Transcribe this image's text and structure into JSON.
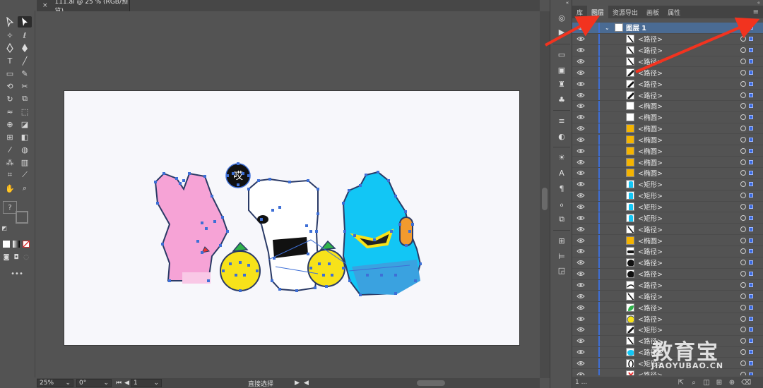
{
  "document": {
    "tab_title": "111.ai @ 25 % (RGB/预览)",
    "close_glyph": "×"
  },
  "status_bar": {
    "zoom": "25%",
    "rotation": "0°",
    "artboard_number": "1",
    "current_tool": "直接选择"
  },
  "panel": {
    "tabs": [
      "库",
      "图层",
      "资源导出",
      "画板",
      "属性"
    ],
    "active_tab": "图层",
    "layer_name": "图层 1",
    "footer_text": "1 ...",
    "items": [
      {
        "label": "<路径>",
        "thumb": "stroke-diag"
      },
      {
        "label": "<路径>",
        "thumb": "stroke-diag"
      },
      {
        "label": "<路径>",
        "thumb": "stroke-diag"
      },
      {
        "label": "<路径>",
        "thumb": "stroke-diag-bold"
      },
      {
        "label": "<路径>",
        "thumb": "stroke-diag-bold"
      },
      {
        "label": "<路径>",
        "thumb": "stroke-diag-bold"
      },
      {
        "label": "<椭圆>",
        "thumb": "white"
      },
      {
        "label": "<椭圆>",
        "thumb": "white"
      },
      {
        "label": "<椭圆>",
        "thumb": "orange"
      },
      {
        "label": "<椭圆>",
        "thumb": "orange"
      },
      {
        "label": "<椭圆>",
        "thumb": "orange"
      },
      {
        "label": "<椭圆>",
        "thumb": "orange"
      },
      {
        "label": "<椭圆>",
        "thumb": "orange"
      },
      {
        "label": "<矩形>",
        "thumb": "cyan-rect"
      },
      {
        "label": "<矩形>",
        "thumb": "cyan-rect"
      },
      {
        "label": "<矩形>",
        "thumb": "cyan-rect"
      },
      {
        "label": "<矩形>",
        "thumb": "cyan-rect"
      },
      {
        "label": "<路径>",
        "thumb": "stroke-diag"
      },
      {
        "label": "<椭圆>",
        "thumb": "orange"
      },
      {
        "label": "<路径>",
        "thumb": "black-bar"
      },
      {
        "label": "<路径>",
        "thumb": "black-blob"
      },
      {
        "label": "<路径>",
        "thumb": "black-blob"
      },
      {
        "label": "<路径>",
        "thumb": "stroke-arc"
      },
      {
        "label": "<路径>",
        "thumb": "stroke-diag"
      },
      {
        "label": "<路径>",
        "thumb": "green-leaf"
      },
      {
        "label": "<路径>",
        "thumb": "yellow-circle"
      },
      {
        "label": "<矩形>",
        "thumb": "stroke-diag-bold"
      },
      {
        "label": "<路径>",
        "thumb": "stroke-diag"
      },
      {
        "label": "<路径>",
        "thumb": "cyan-blob"
      },
      {
        "label": "<矩形>",
        "thumb": "oval-outline"
      },
      {
        "label": "<路径>",
        "thumb": "red-mark"
      }
    ]
  },
  "watermark": {
    "chinese": "教育宝",
    "domain": "JIAOYUBAO.CN"
  },
  "canvas": {
    "speech_bubble_text": "哎"
  },
  "colors": {
    "accent_blue": "#3e6fd6",
    "arrow_red": "#f2331f",
    "bunny_pink": "#f6a3d6",
    "bear_white": "#ffffff",
    "blue_character": "#12c6f5",
    "lemon_yellow": "#f7e21a"
  }
}
